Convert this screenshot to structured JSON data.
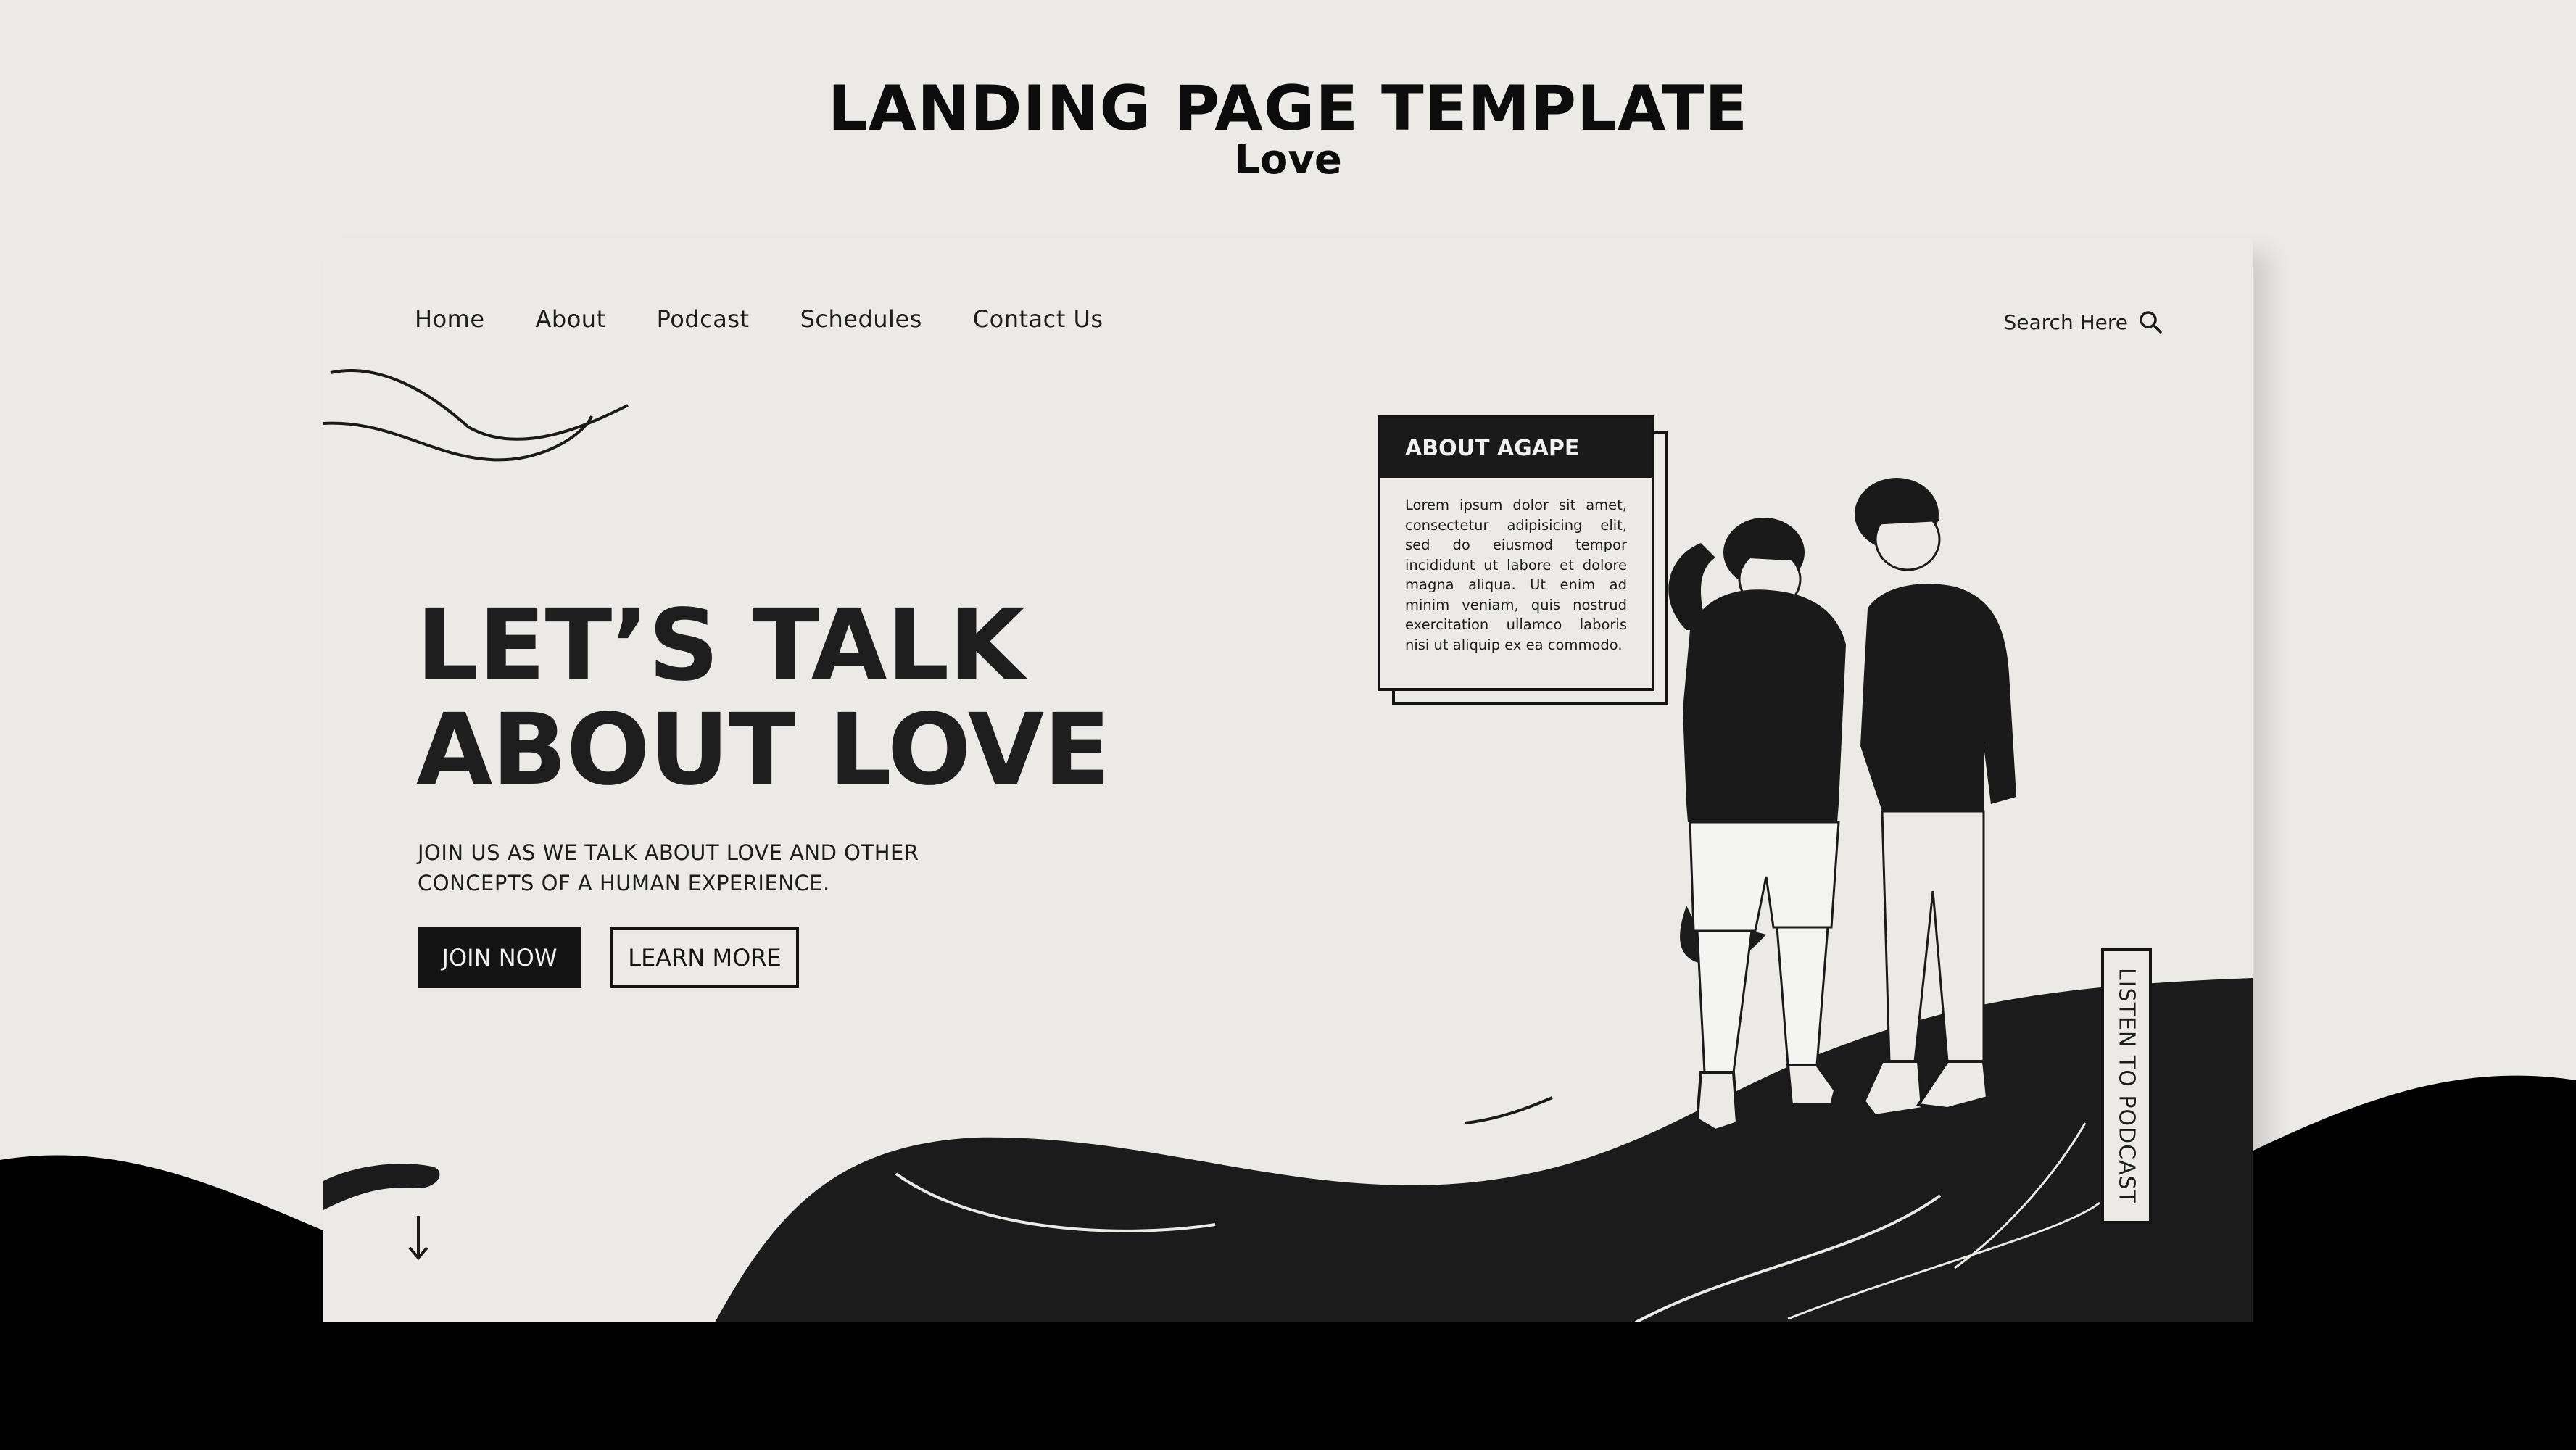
{
  "header": {
    "title": "LANDING PAGE TEMPLATE",
    "subtitle": "Love"
  },
  "nav": {
    "items": [
      {
        "label": "Home"
      },
      {
        "label": "About"
      },
      {
        "label": "Podcast"
      },
      {
        "label": "Schedules"
      },
      {
        "label": "Contact Us"
      }
    ]
  },
  "search": {
    "label": "Search Here",
    "icon": "search-icon"
  },
  "hero": {
    "title_line1": "LET’S TALK",
    "title_line2": "ABOUT LOVE",
    "subtitle": "JOIN US AS WE TALK ABOUT LOVE AND OTHER CONCEPTS OF A HUMAN EXPERIENCE.",
    "join_label": "JOIN NOW",
    "learn_label": "LEARN MORE"
  },
  "info_box": {
    "title": "ABOUT AGAPE",
    "body": "Lorem ipsum dolor sit amet, consectetur adipisicing elit, sed do eiusmod tempor incididunt ut labore et dolore magna aliqua. Ut enim ad minim veniam, quis nostrud exercitation ullamco laboris nisi ut aliquip ex ea commodo."
  },
  "side_tab": {
    "label": "LISTEN TO PODCAST"
  },
  "colors": {
    "background": "#ebeae7",
    "ink": "#141414",
    "light": "#f2f2f2"
  }
}
